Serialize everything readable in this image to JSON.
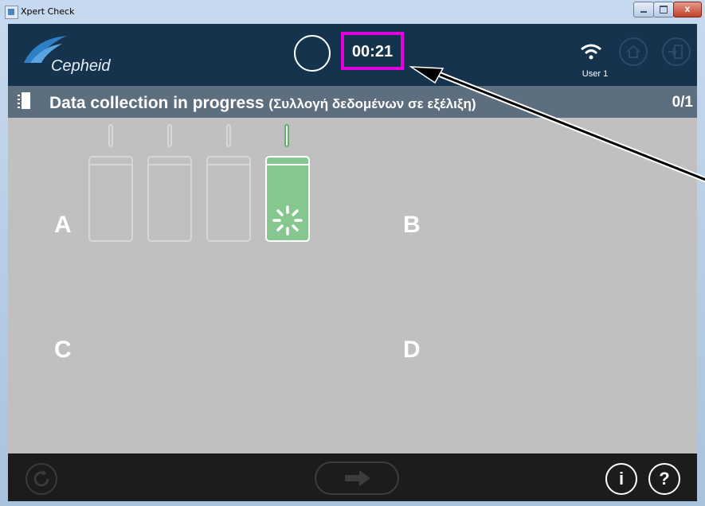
{
  "window": {
    "title": "Xpert Check",
    "close_glyph": "x"
  },
  "header": {
    "logo": "Cepheid",
    "timer": "00:21",
    "user": "User 1",
    "icons": [
      "wifi-icon",
      "home-icon",
      "exit-icon"
    ]
  },
  "status": {
    "title": "Data collection in progress",
    "subtitle": "(Συλλογή δεδομένων σε εξέλιξη)",
    "count": "0/1"
  },
  "modules": {
    "labels": [
      "A",
      "B",
      "C",
      "D"
    ],
    "active_module": 4
  },
  "footer": {
    "info": "i",
    "help": "?",
    "icons": [
      "refresh-icon",
      "arrow-right-icon",
      "info-icon",
      "help-icon"
    ]
  },
  "colors": {
    "header": "#15334d",
    "subheader": "#5d6f7e",
    "panel": "#c0c0c0",
    "footer": "#1c1c1c",
    "active_module": "#86c68f",
    "highlight": "#e000e0"
  }
}
